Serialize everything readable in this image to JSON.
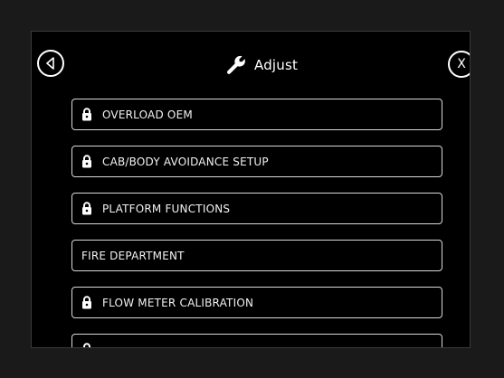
{
  "header": {
    "title": "Adjust",
    "close_label": "X"
  },
  "menu": {
    "items": [
      {
        "label": "OVERLOAD OEM",
        "locked": true
      },
      {
        "label": "CAB/BODY AVOIDANCE SETUP",
        "locked": true
      },
      {
        "label": "PLATFORM FUNCTIONS",
        "locked": true
      },
      {
        "label": "FIRE DEPARTMENT",
        "locked": false
      },
      {
        "label": "FLOW METER CALIBRATION",
        "locked": true
      },
      {
        "label": "",
        "locked": true
      }
    ]
  }
}
